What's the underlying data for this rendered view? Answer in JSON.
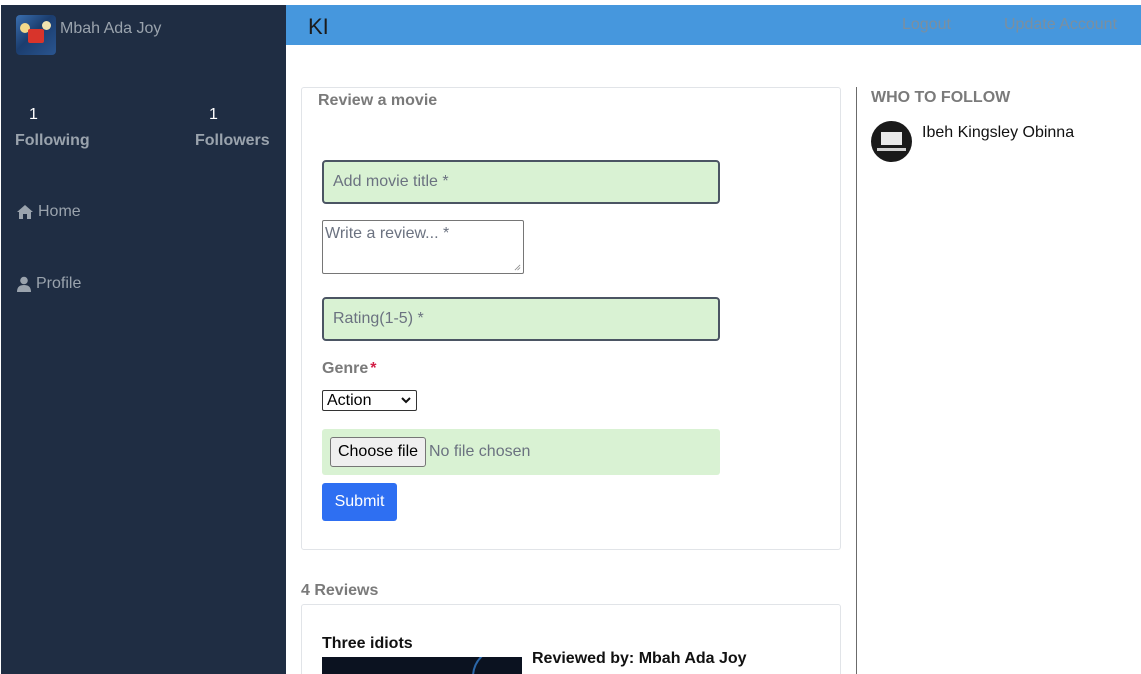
{
  "sidebar": {
    "brand_name": "Mbah Ada Joy",
    "stats": {
      "following_count": "1",
      "following_label": "Following",
      "followers_count": "1",
      "followers_label": "Followers"
    },
    "nav": {
      "home": "Home",
      "profile": "Profile"
    }
  },
  "header": {
    "title": "KI",
    "logout": "Logout",
    "update_account": "Update Account"
  },
  "review_form": {
    "title": "Review a movie",
    "movie_title_placeholder": "Add movie title *",
    "review_placeholder": "Write a review... *",
    "rating_placeholder": "Rating(1-5) *",
    "genre_label": "Genre",
    "genre_required_mark": "*",
    "genre_selected": "Action",
    "file_button": "Choose file",
    "file_status": "No file chosen",
    "submit": "Submit"
  },
  "reviews": {
    "count_label": "4 Reviews",
    "first": {
      "title": "Three idiots",
      "reviewed_by": "Reviewed by: Mbah Ada Joy"
    }
  },
  "who_to_follow": {
    "title": "WHO TO FOLLOW",
    "users": [
      {
        "name": "Ibeh Kingsley Obinna"
      }
    ]
  },
  "colors": {
    "sidebar_bg": "#1f2d43",
    "header_bg": "#4697dd",
    "input_green": "#d9f2d3",
    "submit_blue": "#2e6ff2",
    "required_red": "#d21f47"
  }
}
